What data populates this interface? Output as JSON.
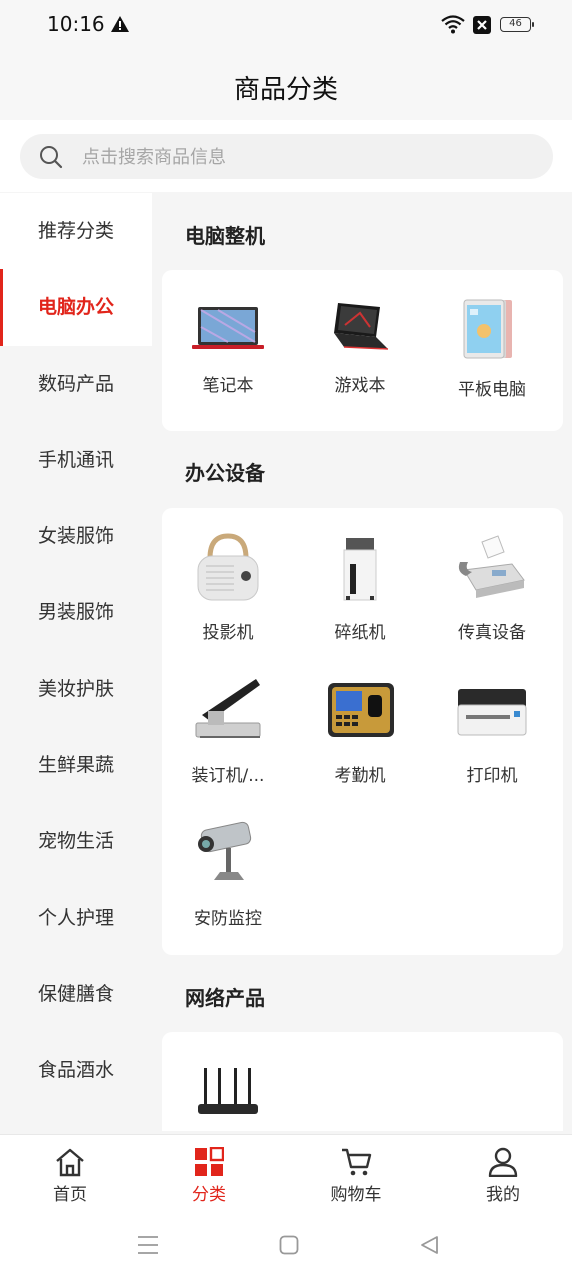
{
  "status_bar": {
    "time": "10:16",
    "battery": "46"
  },
  "header": {
    "title": "商品分类"
  },
  "search": {
    "placeholder": "点击搜索商品信息"
  },
  "sidebar": {
    "items": [
      {
        "label": "推荐分类"
      },
      {
        "label": "电脑办公",
        "active": true
      },
      {
        "label": "数码产品"
      },
      {
        "label": "手机通讯"
      },
      {
        "label": "女装服饰"
      },
      {
        "label": "男装服饰"
      },
      {
        "label": "美妆护肤"
      },
      {
        "label": "生鲜果蔬"
      },
      {
        "label": "宠物生活"
      },
      {
        "label": "个人护理"
      },
      {
        "label": "保健膳食"
      },
      {
        "label": "食品酒水"
      }
    ]
  },
  "sections": [
    {
      "title": "电脑整机",
      "items": [
        {
          "label": "笔记本",
          "icon": "laptop-icon"
        },
        {
          "label": "游戏本",
          "icon": "gaming-laptop-icon"
        },
        {
          "label": "平板电脑",
          "icon": "tablet-icon"
        }
      ]
    },
    {
      "title": "办公设备",
      "items": [
        {
          "label": "投影机",
          "icon": "projector-icon"
        },
        {
          "label": "碎纸机",
          "icon": "shredder-icon"
        },
        {
          "label": "传真设备",
          "icon": "fax-icon"
        },
        {
          "label": "装订机/...",
          "icon": "binding-machine-icon"
        },
        {
          "label": "考勤机",
          "icon": "attendance-machine-icon"
        },
        {
          "label": "打印机",
          "icon": "printer-icon"
        },
        {
          "label": "安防监控",
          "icon": "security-camera-icon"
        }
      ]
    },
    {
      "title": "网络产品",
      "items": [
        {
          "label": "",
          "icon": "router-icon"
        }
      ]
    }
  ],
  "bottom_nav": {
    "items": [
      {
        "label": "首页",
        "icon": "home-icon"
      },
      {
        "label": "分类",
        "icon": "category-icon",
        "active": true
      },
      {
        "label": "购物车",
        "icon": "cart-icon"
      },
      {
        "label": "我的",
        "icon": "user-icon"
      }
    ]
  },
  "colors": {
    "accent": "#e1251b",
    "background": "#f5f5f5",
    "card": "#ffffff"
  }
}
